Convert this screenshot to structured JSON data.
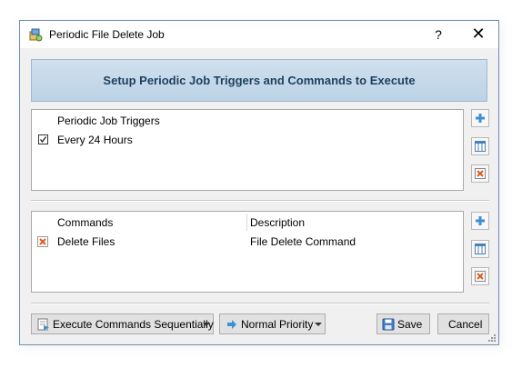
{
  "window": {
    "title": "Periodic File Delete Job",
    "help_label": "?",
    "close_label": "✕"
  },
  "banner": {
    "text": "Setup Periodic Job Triggers and Commands to Execute"
  },
  "triggers": {
    "header": "Periodic Job Triggers",
    "items": [
      {
        "label": "Every 24 Hours",
        "checked": true
      }
    ]
  },
  "commands": {
    "headers": [
      "Commands",
      "Description"
    ],
    "rows": [
      {
        "command": "Delete Files",
        "description": "File Delete Command"
      }
    ]
  },
  "bottom": {
    "execute_mode": "Execute Commands Sequentially",
    "priority": "Normal Priority",
    "save": "Save",
    "cancel": "Cancel"
  },
  "colors": {
    "add": "#3d8fd6",
    "delete": "#e05a1e",
    "banner_text": "#1e3f5e"
  },
  "icons": {
    "add": "plus-icon",
    "edit": "columns-icon",
    "delete": "x-box-icon",
    "save": "floppy-disk-icon",
    "execute": "execute-icon",
    "priority": "arrow-right-icon"
  }
}
